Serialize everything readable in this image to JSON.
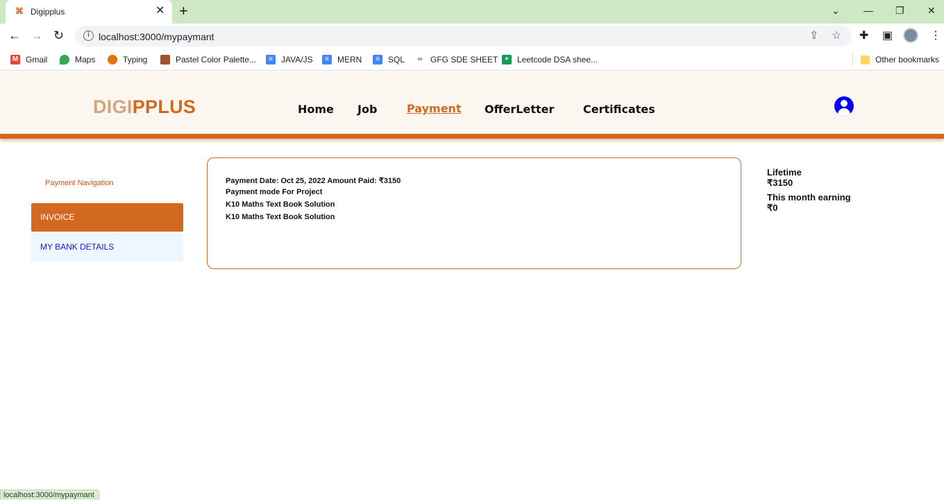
{
  "browser": {
    "tab_title": "Digipplus",
    "url": "localhost:3000/mypaymant",
    "bookmarks": [
      {
        "label": "Gmail",
        "icon": "gmail-icon",
        "color": "#ea4335"
      },
      {
        "label": "Maps",
        "icon": "maps-pin-icon",
        "color": "#34a853"
      },
      {
        "label": "Typing",
        "icon": "typing-icon",
        "color": "#e8710a"
      },
      {
        "label": "Pastel Color Palette...",
        "icon": "palette-icon",
        "color": "#a0522d"
      },
      {
        "label": "JAVA/JS",
        "icon": "docs-icon",
        "color": "#4285f4"
      },
      {
        "label": "MERN",
        "icon": "docs-icon",
        "color": "#4285f4"
      },
      {
        "label": "SQL",
        "icon": "docs-icon",
        "color": "#4285f4"
      },
      {
        "label": "GFG SDE SHEET",
        "icon": "gfg-icon",
        "color": "#2f8d46"
      },
      {
        "label": "Leetcode DSA shee...",
        "icon": "sheets-icon",
        "color": "#0f9d58"
      }
    ],
    "other_bookmarks": "Other bookmarks",
    "status_url": "localhost:3000/mypaymant"
  },
  "site": {
    "logo_part1": "DIGI",
    "logo_part2": "PPLUS",
    "nav": {
      "home": "Home",
      "job": "Job",
      "payment": "Payment",
      "offer_letter": "OfferLetter",
      "certificates": "Certificates"
    },
    "brand_color": "#d2691e"
  },
  "sidebar": {
    "title": "Payment Navigation",
    "invoice": "INVOICE",
    "bank": "MY BANK DETAILS"
  },
  "payment": {
    "line1": "Payment Date: Oct 25, 2022 Amount Paid: ₹3150",
    "line2": "Payment mode For Project",
    "line3": "K10 Maths Text Book Solution",
    "line4": "K10 Maths Text Book Solution"
  },
  "earnings": {
    "lifetime_label": "Lifetime",
    "lifetime_value": "₹3150",
    "month_label": "This month earning",
    "month_value": "₹0"
  }
}
